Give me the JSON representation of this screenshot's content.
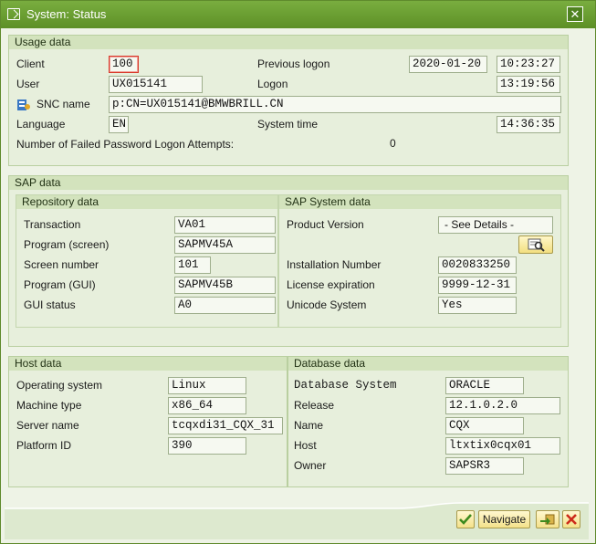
{
  "window": {
    "title": "System: Status"
  },
  "usage": {
    "header": "Usage data",
    "client_label": "Client",
    "client_value": "100",
    "user_label": "User",
    "user_value": "UX015141",
    "snc_label": "SNC name",
    "snc_value": "p:CN=UX015141@BMWBRILL.CN",
    "language_label": "Language",
    "language_value": "EN",
    "failed_label": "Number of Failed Password Logon Attempts:",
    "failed_value": "0",
    "prev_logon_label": "Previous logon",
    "prev_logon_date": "2020-01-20",
    "prev_logon_time": "10:23:27",
    "logon_label": "Logon",
    "logon_time": "13:19:56",
    "system_time_label": "System time",
    "system_time": "14:36:35"
  },
  "sap": {
    "header": "SAP data",
    "repo_header": "Repository data",
    "transaction_label": "Transaction",
    "transaction_value": "VA01",
    "program_screen_label": "Program (screen)",
    "program_screen_value": "SAPMV45A",
    "screen_number_label": "Screen number",
    "screen_number_value": "101",
    "program_gui_label": "Program (GUI)",
    "program_gui_value": "SAPMV45B",
    "gui_status_label": "GUI status",
    "gui_status_value": "A0",
    "system_header": "SAP System data",
    "product_version_label": "Product Version",
    "product_version_value": "- See Details -",
    "installation_label": "Installation Number",
    "installation_value": "0020833250",
    "license_label": "License expiration",
    "license_value": "9999-12-31",
    "unicode_label": "Unicode System",
    "unicode_value": "Yes"
  },
  "host": {
    "header": "Host data",
    "os_label": "Operating system",
    "os_value": "Linux",
    "machine_label": "Machine type",
    "machine_value": "x86_64",
    "server_label": "Server name",
    "server_value": "tcqxdi31_CQX_31",
    "platform_label": "Platform ID",
    "platform_value": "390"
  },
  "db": {
    "header": "Database data",
    "system_label": "Database System",
    "system_value": "ORACLE",
    "release_label": "Release",
    "release_value": "12.1.0.2.0",
    "name_label": "Name",
    "name_value": "CQX",
    "host_label": "Host",
    "host_value": "ltxtix0cqx01",
    "owner_label": "Owner",
    "owner_value": "SAPSR3"
  },
  "footer": {
    "navigate_label": "Navigate"
  },
  "icons": [
    "window-icon",
    "close-icon",
    "snc-icon",
    "details-icon",
    "check-icon",
    "navigate-icon",
    "cancel-icon"
  ]
}
